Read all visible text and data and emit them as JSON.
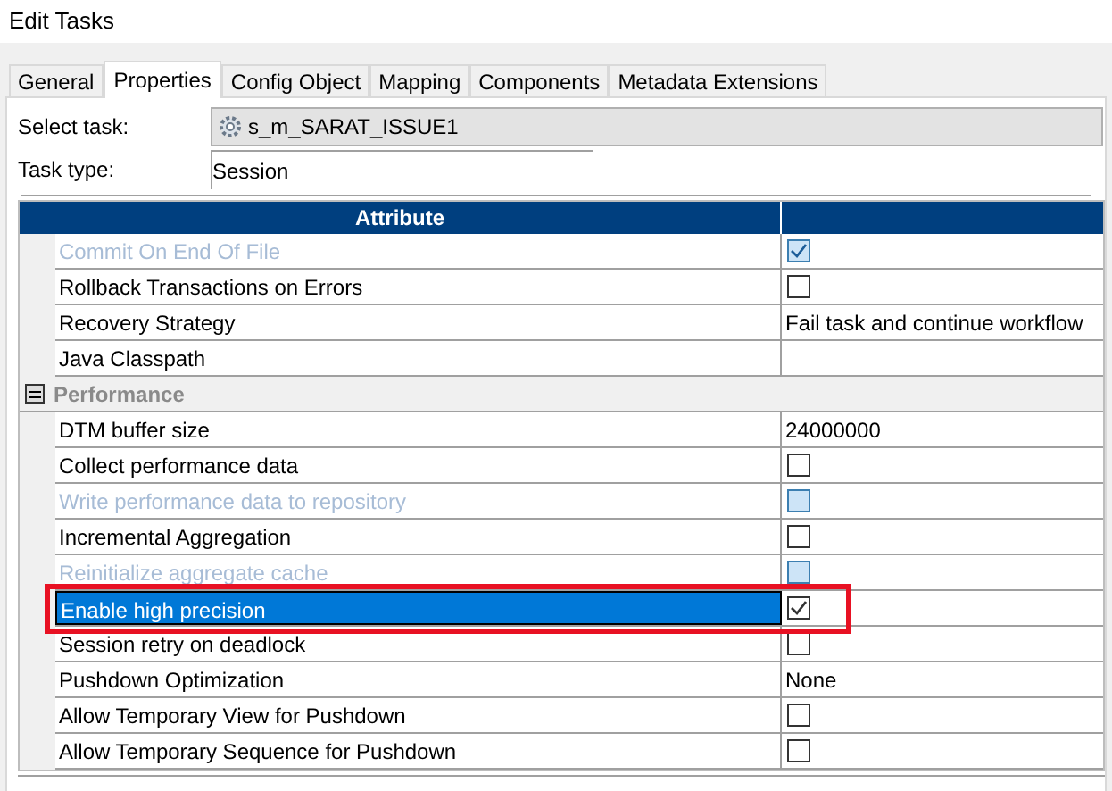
{
  "window": {
    "title": "Edit Tasks"
  },
  "tabs": [
    {
      "label": "General",
      "selected": false
    },
    {
      "label": "Properties",
      "selected": true
    },
    {
      "label": "Config Object",
      "selected": false
    },
    {
      "label": "Mapping",
      "selected": false
    },
    {
      "label": "Components",
      "selected": false
    },
    {
      "label": "Metadata Extensions",
      "selected": false
    }
  ],
  "select_task": {
    "label": "Select task:",
    "value": "s_m_SARAT_ISSUE1"
  },
  "task_type": {
    "label": "Task type:",
    "value": "Session"
  },
  "table": {
    "columns": [
      "Attribute"
    ],
    "rows": [
      {
        "kind": "checkbox",
        "name": "Commit On End Of File",
        "checked": true,
        "disabled": true,
        "selected": false
      },
      {
        "kind": "checkbox",
        "name": "Rollback Transactions on Errors",
        "checked": false,
        "disabled": false,
        "selected": false
      },
      {
        "kind": "text",
        "name": "Recovery Strategy",
        "value": "Fail task and continue workflow",
        "selected": false
      },
      {
        "kind": "text",
        "name": "Java Classpath",
        "selected": false
      },
      {
        "kind": "section",
        "name": "Performance",
        "expanded": true
      },
      {
        "kind": "text",
        "name": "DTM buffer size",
        "value": "24000000",
        "selected": false
      },
      {
        "kind": "checkbox",
        "name": "Collect performance data",
        "checked": false,
        "disabled": false,
        "selected": false
      },
      {
        "kind": "checkbox",
        "name": "Write performance data to repository",
        "checked": false,
        "disabled": true,
        "selected": false
      },
      {
        "kind": "checkbox",
        "name": "Incremental Aggregation",
        "checked": false,
        "disabled": false,
        "selected": false
      },
      {
        "kind": "checkbox",
        "name": "Reinitialize aggregate cache",
        "checked": false,
        "disabled": true,
        "selected": false
      },
      {
        "kind": "checkbox",
        "name": "Enable high precision",
        "checked": true,
        "disabled": false,
        "selected": true
      },
      {
        "kind": "checkbox",
        "name": "Session retry on deadlock",
        "checked": false,
        "disabled": false,
        "selected": false
      },
      {
        "kind": "text",
        "name": "Pushdown Optimization",
        "value": "None",
        "selected": false
      },
      {
        "kind": "checkbox",
        "name": "Allow Temporary View for Pushdown",
        "checked": false,
        "disabled": false,
        "selected": false
      },
      {
        "kind": "checkbox",
        "name": "Allow Temporary Sequence for Pushdown",
        "checked": false,
        "disabled": false,
        "selected": false
      }
    ]
  }
}
